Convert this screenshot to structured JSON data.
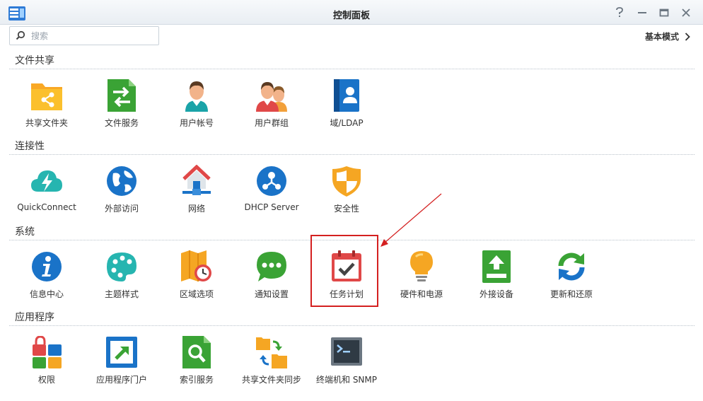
{
  "window": {
    "title": "控制面板"
  },
  "search": {
    "placeholder": "搜索"
  },
  "header": {
    "basic_mode_label": "基本模式"
  },
  "sections": [
    {
      "title": "文件共享",
      "items": [
        {
          "label": "共享文件夹",
          "icon": "shared-folder-icon"
        },
        {
          "label": "文件服务",
          "icon": "file-services-icon"
        },
        {
          "label": "用户帐号",
          "icon": "user-account-icon"
        },
        {
          "label": "用户群组",
          "icon": "user-group-icon"
        },
        {
          "label": "域/LDAP",
          "icon": "domain-ldap-icon"
        }
      ]
    },
    {
      "title": "连接性",
      "items": [
        {
          "label": "QuickConnect",
          "icon": "quickconnect-icon"
        },
        {
          "label": "外部访问",
          "icon": "external-access-icon"
        },
        {
          "label": "网络",
          "icon": "network-icon"
        },
        {
          "label": "DHCP Server",
          "icon": "dhcp-server-icon"
        },
        {
          "label": "安全性",
          "icon": "security-shield-icon"
        }
      ]
    },
    {
      "title": "系统",
      "items": [
        {
          "label": "信息中心",
          "icon": "info-center-icon"
        },
        {
          "label": "主题样式",
          "icon": "theme-palette-icon"
        },
        {
          "label": "区域选项",
          "icon": "regional-options-icon"
        },
        {
          "label": "通知设置",
          "icon": "notification-icon"
        },
        {
          "label": "任务计划",
          "icon": "task-scheduler-icon"
        },
        {
          "label": "硬件和电源",
          "icon": "hardware-power-icon"
        },
        {
          "label": "外接设备",
          "icon": "external-devices-icon"
        },
        {
          "label": "更新和还原",
          "icon": "update-restore-icon"
        }
      ]
    },
    {
      "title": "应用程序",
      "items": [
        {
          "label": "权限",
          "icon": "privileges-icon"
        },
        {
          "label": "应用程序门户",
          "icon": "application-portal-icon"
        },
        {
          "label": "索引服务",
          "icon": "indexing-service-icon"
        },
        {
          "label": "共享文件夹同步",
          "icon": "shared-folder-sync-icon"
        },
        {
          "label": "终端机和 SNMP",
          "icon": "terminal-snmp-icon"
        }
      ]
    }
  ],
  "colors": {
    "highlight": "#d42020",
    "accent_blue": "#1a73c8",
    "green": "#3aa335",
    "orange": "#f5a623"
  }
}
